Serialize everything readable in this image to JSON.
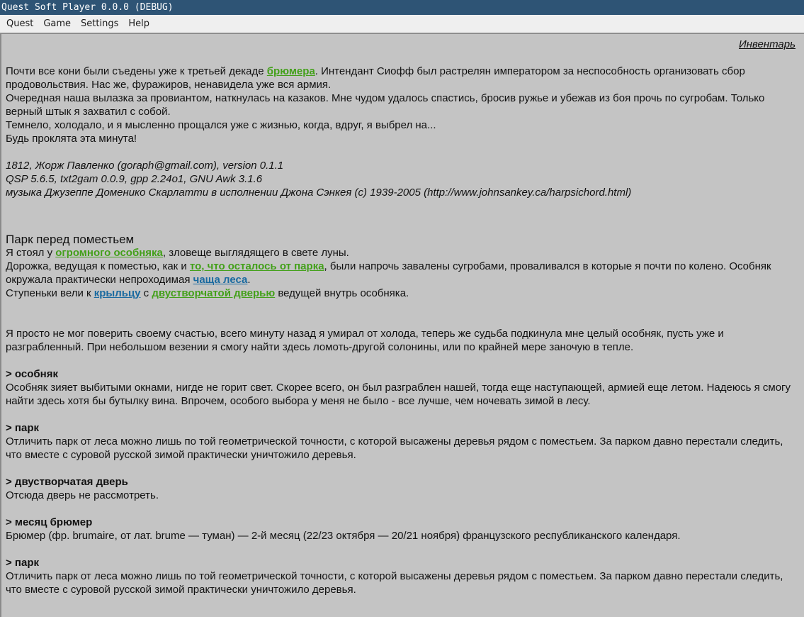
{
  "window": {
    "title": "Quest Soft Player 0.0.0 (DEBUG)"
  },
  "menu": {
    "items": [
      {
        "label": "Quest"
      },
      {
        "label": "Game"
      },
      {
        "label": "Settings"
      },
      {
        "label": "Help"
      }
    ]
  },
  "inventory_link": "Инвентарь",
  "colors": {
    "titlebar": "#2e5475",
    "background": "#c4c4c4",
    "link_green": "#43a01a",
    "link_blue": "#1a6aa0"
  },
  "intro": {
    "p1_a": " Почти все кони были съедены уже к третьей декаде ",
    "p1_link": "брюмера",
    "p1_b": ". Интендант Сиофф был растрелян императором за неспособность организовать сбор продовольствия. Нас же, фуражиров, ненавидела уже вся армия.",
    "p2": " Очередная наша вылазка за провиантом, наткнулась на казаков. Мне чудом удалось спастись, бросив ружье и убежав из боя прочь по сугробам. Только верный штык я захватил с собой.",
    "p3": " Темнело, холодало, и я мысленно прощался уже с жизнью, когда, вдруг, я выбрел на...",
    "p4": " Будь проклята эта минута!"
  },
  "credits": {
    "line1": "1812, Жорж Павленко (goraph@gmail.com), version 0.1.1",
    "line2": "QSP 5.6.5, txt2gam 0.0.9, gpp 2.24o1, GNU Awk 3.1.6",
    "line3": "музыка Джузеппе Доменико Скарлатти в исполнении Джона Сэнкея (c) 1939-2005 (http://www.johnsankey.ca/harpsichord.html)"
  },
  "location": {
    "title": " Парк перед поместьем",
    "l1_a": " Я стоял у ",
    "l1_link": "огромного особняка",
    "l1_b": ", зловеще выглядящего в свете луны.",
    "l2_a": " Дорожка, ведущая к поместью, как и ",
    "l2_link": "то, что осталось от парка",
    "l2_b": ", были напрочь завалены сугробами, проваливался в которые я почти по колено. Особняк окружала практически непроходимая ",
    "l2_link2": "чаща леса",
    "l2_c": ".",
    "l3_a": " Ступеньки вели к ",
    "l3_link": "крыльцу",
    "l3_b": " с ",
    "l3_link2": "двустворчатой дверью",
    "l3_c": " ведущей внутрь особняка."
  },
  "relief": " Я просто не мог поверить своему счастью, всего минуту назад я умирал от холода, теперь же судьба подкинула мне целый особняк, пусть уже и разграбленный. При небольшом везении я смогу найти здесь ломоть-другой солонины, или по крайней мере заночую в тепле.",
  "log": [
    {
      "heading": "> особняк",
      "text": " Особняк зияет выбитыми окнами, нигде не горит свет. Скорее всего, он был разграблен нашей, тогда еще наступающей, армией еще летом. Надеюсь я смогу найти здесь хотя бы бутылку вина. Впрочем, особого выбора у меня не было - все лучше, чем ночевать зимой в лесу."
    },
    {
      "heading": "> парк",
      "text": " Отличить парк от леса можно лишь по той геометрической точности, с которой высажены деревья рядом с поместьем. За парком давно перестали следить, что вместе с суровой русской зимой практически уничтожило деревья."
    },
    {
      "heading": "> двустворчатая дверь",
      "text": " Отсюда дверь не рассмотреть."
    },
    {
      "heading": "> месяц брюмер",
      "text": " Брюмер (фр. brumaire, от лат. brume — туман) — 2-й месяц (22/23 октября — 20/21 ноября) французского республиканского календаря."
    },
    {
      "heading": "> парк",
      "text": " Отличить парк от леса можно лишь по той геометрической точности, с которой высажены деревья рядом с поместьем. За парком давно перестали следить, что вместе с суровой русской зимой практически уничтожило деревья."
    }
  ]
}
